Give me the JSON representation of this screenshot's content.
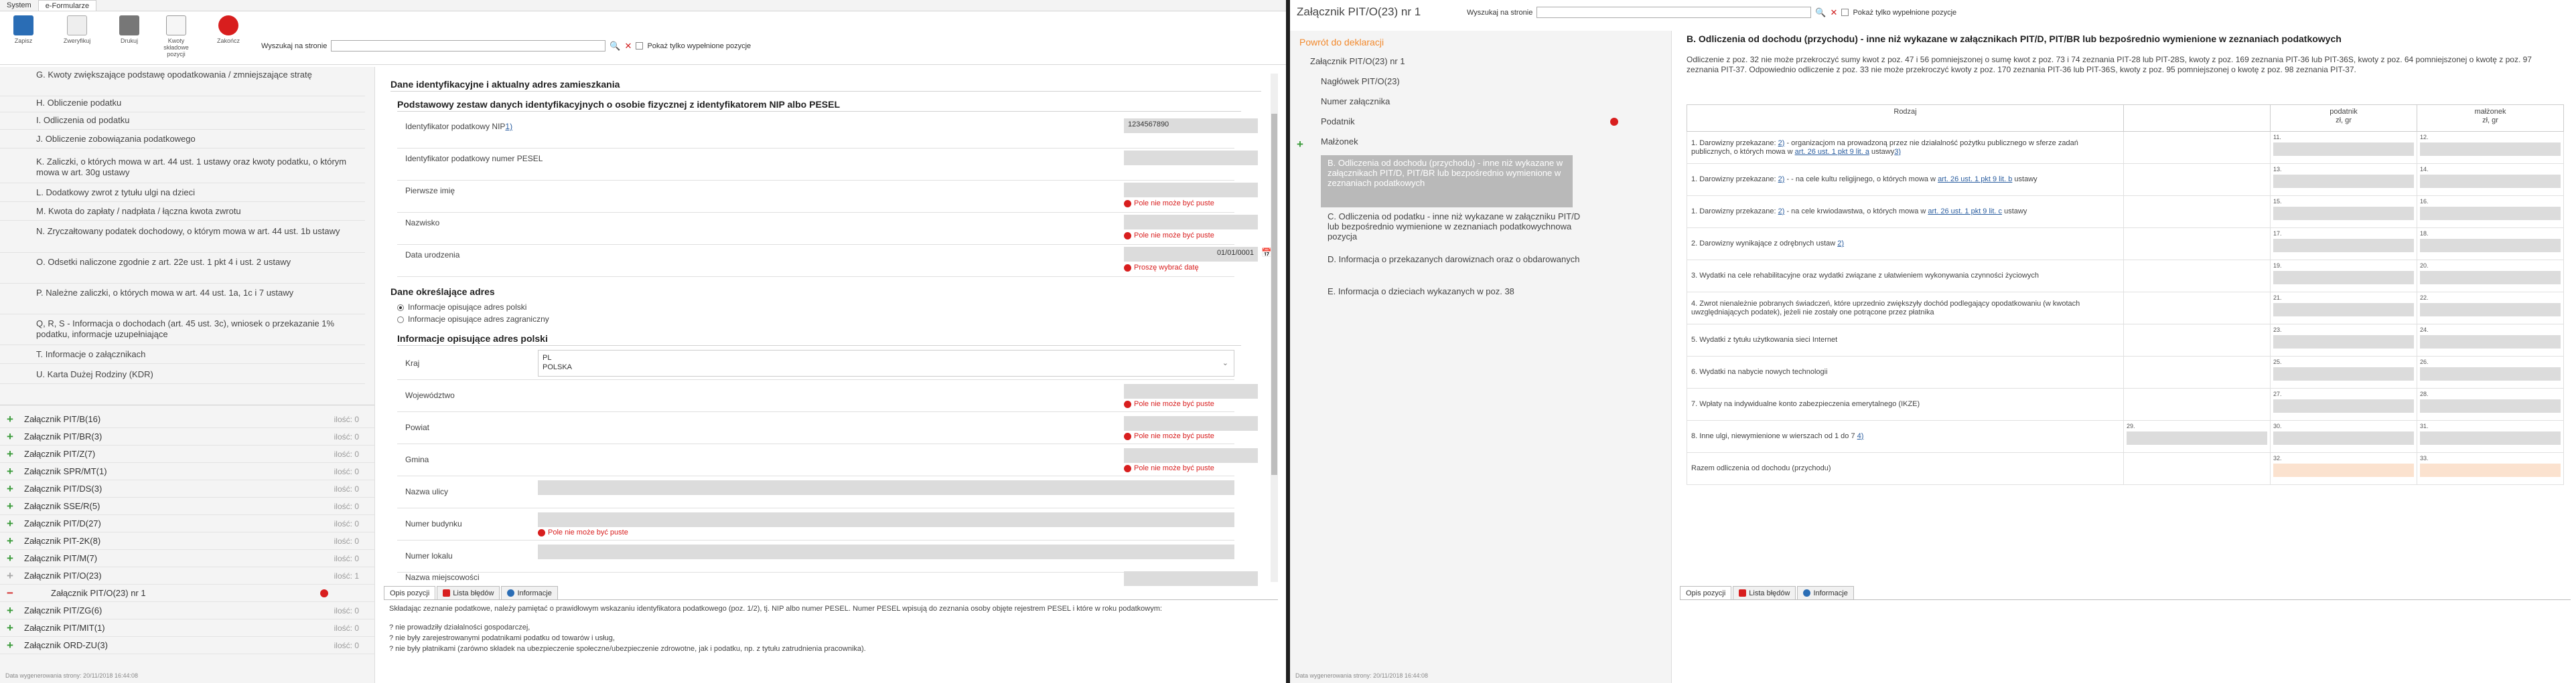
{
  "left": {
    "menubar": {
      "tabs": [
        "System",
        "e-Formularze"
      ]
    },
    "ribbon": {
      "buttons": [
        "Zapisz",
        "Zweryfikuj",
        "Drukuj",
        "Kwoty składowe pozycji",
        "Zakończ"
      ],
      "search_label": "Wyszukaj na stronie",
      "only_filled_label": "Pokaż tylko wypełnione pozycje"
    },
    "nav": {
      "sections": [
        "G. Kwoty zwiększające podstawę opodatkowania / zmniejszające stratę",
        "H. Obliczenie podatku",
        "I. Odliczenia od podatku",
        "J. Obliczenie zobowiązania podatkowego",
        "K. Zaliczki, o których mowa w art. 44 ust. 1 ustawy oraz kwoty podatku, o którym mowa w art. 30g ustawy",
        "L. Dodatkowy zwrot z tytułu ulgi na dzieci",
        "M. Kwota do zapłaty / nadpłata / łączna kwota zwrotu",
        "N. Zryczałtowany podatek dochodowy, o którym mowa w art. 44 ust. 1b ustawy",
        "O. Odsetki naliczone zgodnie z art. 22e ust. 1 pkt 4 i ust. 2 ustawy",
        "P. Należne zaliczki, o których mowa w art. 44 ust. 1a, 1c i 7 ustawy",
        "Q, R, S - Informacja o dochodach (art. 45 ust. 3c), wniosek o przekazanie 1% podatku, informacje uzupełniające",
        "T. Informacje o załącznikach",
        "U. Karta Dużej Rodziny (KDR)"
      ],
      "attachments": [
        {
          "name": "Załącznik PIT/B(16)",
          "count": "ilość: 0"
        },
        {
          "name": "Załącznik PIT/BR(3)",
          "count": "ilość: 0"
        },
        {
          "name": "Załącznik PIT/Z(7)",
          "count": "ilość: 0"
        },
        {
          "name": "Załącznik SPR/MT(1)",
          "count": "ilość: 0"
        },
        {
          "name": "Załącznik PIT/DS(3)",
          "count": "ilość: 0"
        },
        {
          "name": "Załącznik SSE/R(5)",
          "count": "ilość: 0"
        },
        {
          "name": "Załącznik PIT/D(27)",
          "count": "ilość: 0"
        },
        {
          "name": "Załącznik PIT-2K(8)",
          "count": "ilość: 0"
        },
        {
          "name": "Załącznik PIT/M(7)",
          "count": "ilość: 0"
        },
        {
          "name": "Załącznik PIT/O(23)",
          "count": "ilość: 1"
        },
        {
          "name": "Załącznik PIT/O(23) nr 1",
          "count": ""
        },
        {
          "name": "Załącznik PIT/ZG(6)",
          "count": "ilość: 0"
        },
        {
          "name": "Załącznik PIT/MIT(1)",
          "count": "ilość: 0"
        },
        {
          "name": "Załącznik ORD-ZU(3)",
          "count": "ilość: 0"
        }
      ]
    },
    "content": {
      "heading": "Dane identyfikacyjne i aktualny adres zamieszkania",
      "sub1": "Podstawowy zestaw danych identyfikacyjnych o osobie fizycznej z identyfikatorem NIP albo PESEL",
      "fields": [
        {
          "label": "Identyfikator podatkowy NIP",
          "link": "1)",
          "value": "1234567890",
          "error": ""
        },
        {
          "label": "Identyfikator podatkowy numer PESEL",
          "link": "",
          "value": "",
          "error": ""
        },
        {
          "label": "Pierwsze imię",
          "link": "",
          "value": "",
          "error": "Pole nie może być puste"
        },
        {
          "label": "Nazwisko",
          "link": "",
          "value": "",
          "error": "Pole nie może być puste"
        },
        {
          "label": "Data urodzenia",
          "link": "",
          "value": "01/01/0001",
          "error": "Proszę wybrać datę"
        }
      ],
      "sub2": "Dane określające adres",
      "radio1": "Informacje opisujące adres polski",
      "radio2": "Informacje opisujące adres zagraniczny",
      "sub3": "Informacje opisujące adres polski",
      "kraj_label": "Kraj",
      "kraj_code": "PL",
      "kraj_name": "POLSKA",
      "address": [
        {
          "label": "Województwo",
          "error": "Pole nie może być puste"
        },
        {
          "label": "Powiat",
          "error": "Pole nie może być puste"
        },
        {
          "label": "Gmina",
          "error": "Pole nie może być puste"
        },
        {
          "label": "Nazwa ulicy",
          "error": ""
        },
        {
          "label": "Numer budynku",
          "error": "Pole nie może być puste"
        },
        {
          "label": "Numer lokalu",
          "error": ""
        },
        {
          "label": "Nazwa miejscowości",
          "error": "Pole nie może być puste"
        }
      ]
    },
    "bottom": {
      "tabs": [
        "Opis pozycji",
        "Lista błędów",
        "Informacje"
      ],
      "text": [
        "Składając zeznanie podatkowe, należy pamiętać o prawidłowym wskazaniu identyfikatora podatkowego (poz. 1/2), tj. NIP albo numer PESEL. Numer PESEL wpisują do zeznania osoby objęte rejestrem PESEL i które w roku podatkowym:",
        "",
        "? nie prowadziły działalności gospodarczej,",
        "? nie były zarejestrowanymi podatnikami podatku od towarów i usług,",
        "? nie były płatnikami (zarówno składek na ubezpieczenie społeczne/ubezpieczenie zdrowotne, jak i podatku, np. z tytułu zatrudnienia pracownika)."
      ]
    },
    "footer": "Data wygenerowania strony: 20/11/2018 16:44:08"
  },
  "right": {
    "title": "Załącznik PIT/O(23) nr 1",
    "search_label": "Wyszukaj na stronie",
    "only_filled_label": "Pokaż tylko wypełnione pozycje",
    "nav": {
      "back": "Powrót do deklaracji",
      "items": [
        "Załącznik PIT/O(23) nr 1",
        "Nagłówek PIT/O(23)",
        "Numer załącznika",
        "Podatnik",
        "Małżonek"
      ],
      "highlight": "B. Odliczenia od dochodu (przychodu) - inne niż wykazane w załącznikach PIT/D, PIT/BR lub bezpośrednio wymienione w zeznaniach podatkowych",
      "rest": [
        "C. Odliczenia od podatku - inne niż wykazane w załączniku PIT/D lub bezpośrednio wymienione w zeznaniach podatkowychnowa pozycja",
        "D. Informacja o przekazanych darowiznach oraz o obdarowanych",
        "E. Informacja o dzieciach wykazanych w poz. 38"
      ]
    },
    "content": {
      "title": "B. Odliczenia od dochodu (przychodu) - inne niż wykazane w załącznikach PIT/D, PIT/BR lub bezpośrednio wymienione w zeznaniach podatkowych",
      "desc": "Odliczenie z poz. 32 nie może przekroczyć sumy kwot z poz. 47 i 56 pomniejszonej o sumę kwot z poz. 73 i 74 zeznania PIT-28 lub PIT-28S, kwoty z poz. 169 zeznania PIT-36 lub PIT-36S, kwoty z poz. 64 pomniejszonej o kwotę z poz. 97 zeznania PIT-37. Odpowiednio odliczenie z poz. 33 nie może przekroczyć kwoty z poz. 170 zeznania PIT-36 lub PIT-36S, kwoty z poz. 95 pomniejszonej o kwotę z poz. 98 zeznania PIT-37.",
      "columns": [
        "Rodzaj",
        "podatnik\nzł, gr",
        "małżonek\nzł, gr"
      ],
      "rows": [
        {
          "pre": "1. Darowizny przekazane: ",
          "l1": "2)",
          "mid": " - organizacjom na prowadzoną przez nie działalność pożytku publicznego w sferze zadań publicznych, o których mowa w ",
          "l2": "art. 26 ust. 1 pkt 9 lit. a",
          "post": " ustawy",
          "l3": "3)",
          "n1": "",
          "n2": "11.",
          "n3": "12."
        },
        {
          "pre": "1. Darowizny przekazane: ",
          "l1": "2)",
          "mid": " - - na cele kultu religijnego, o których mowa w ",
          "l2": "art. 26 ust. 1 pkt 9 lit. b",
          "post": " ustawy",
          "l3": "",
          "n1": "",
          "n2": "13.",
          "n3": "14."
        },
        {
          "pre": "1. Darowizny przekazane: ",
          "l1": "2)",
          "mid": " - na cele krwiodawstwa, o których mowa w ",
          "l2": "art. 26 ust. 1 pkt 9 lit. c",
          "post": " ustawy",
          "l3": "",
          "n1": "",
          "n2": "15.",
          "n3": "16."
        },
        {
          "pre": "2. Darowizny wynikające z odrębnych ustaw ",
          "l1": "2)",
          "mid": "",
          "l2": "",
          "post": "",
          "l3": "",
          "n1": "",
          "n2": "17.",
          "n3": "18."
        },
        {
          "pre": "3. Wydatki na cele rehabilitacyjne oraz wydatki związane z ułatwieniem wykonywania czynności życiowych",
          "l1": "",
          "mid": "",
          "l2": "",
          "post": "",
          "l3": "",
          "n1": "",
          "n2": "19.",
          "n3": "20."
        },
        {
          "pre": "4. Zwrot nienależnie pobranych świadczeń, które uprzednio zwiększyły dochód podlegający opodatkowaniu (w kwotach uwzględniających podatek), jeżeli nie zostały one potrącone przez płatnika",
          "l1": "",
          "mid": "",
          "l2": "",
          "post": "",
          "l3": "",
          "n1": "",
          "n2": "21.",
          "n3": "22."
        },
        {
          "pre": "5. Wydatki z tytułu użytkowania sieci Internet",
          "l1": "",
          "mid": "",
          "l2": "",
          "post": "",
          "l3": "",
          "n1": "",
          "n2": "23.",
          "n3": "24."
        },
        {
          "pre": "6. Wydatki na nabycie nowych technologii",
          "l1": "",
          "mid": "",
          "l2": "",
          "post": "",
          "l3": "",
          "n1": "",
          "n2": "25.",
          "n3": "26."
        },
        {
          "pre": "7. Wpłaty na indywidualne konto zabezpieczenia emerytalnego (IKZE)",
          "l1": "",
          "mid": "",
          "l2": "",
          "post": "",
          "l3": "",
          "n1": "",
          "n2": "27.",
          "n3": "28."
        },
        {
          "pre": "8. Inne ulgi, niewymienione w wierszach od 1 do 7 ",
          "l1": "4)",
          "mid": "",
          "l2": "",
          "post": "",
          "l3": "",
          "n1": "29.",
          "n2": "30.",
          "n3": "31."
        },
        {
          "pre": "Razem odliczenia od dochodu (przychodu)",
          "l1": "",
          "mid": "",
          "l2": "",
          "post": "",
          "l3": "",
          "n1": "",
          "n2": "32.",
          "n3": "33."
        }
      ]
    },
    "bottom": {
      "tabs": [
        "Opis pozycji",
        "Lista błędów",
        "Informacje"
      ]
    },
    "footer": "Data wygenerowania strony: 20/11/2018 16:44:08"
  }
}
